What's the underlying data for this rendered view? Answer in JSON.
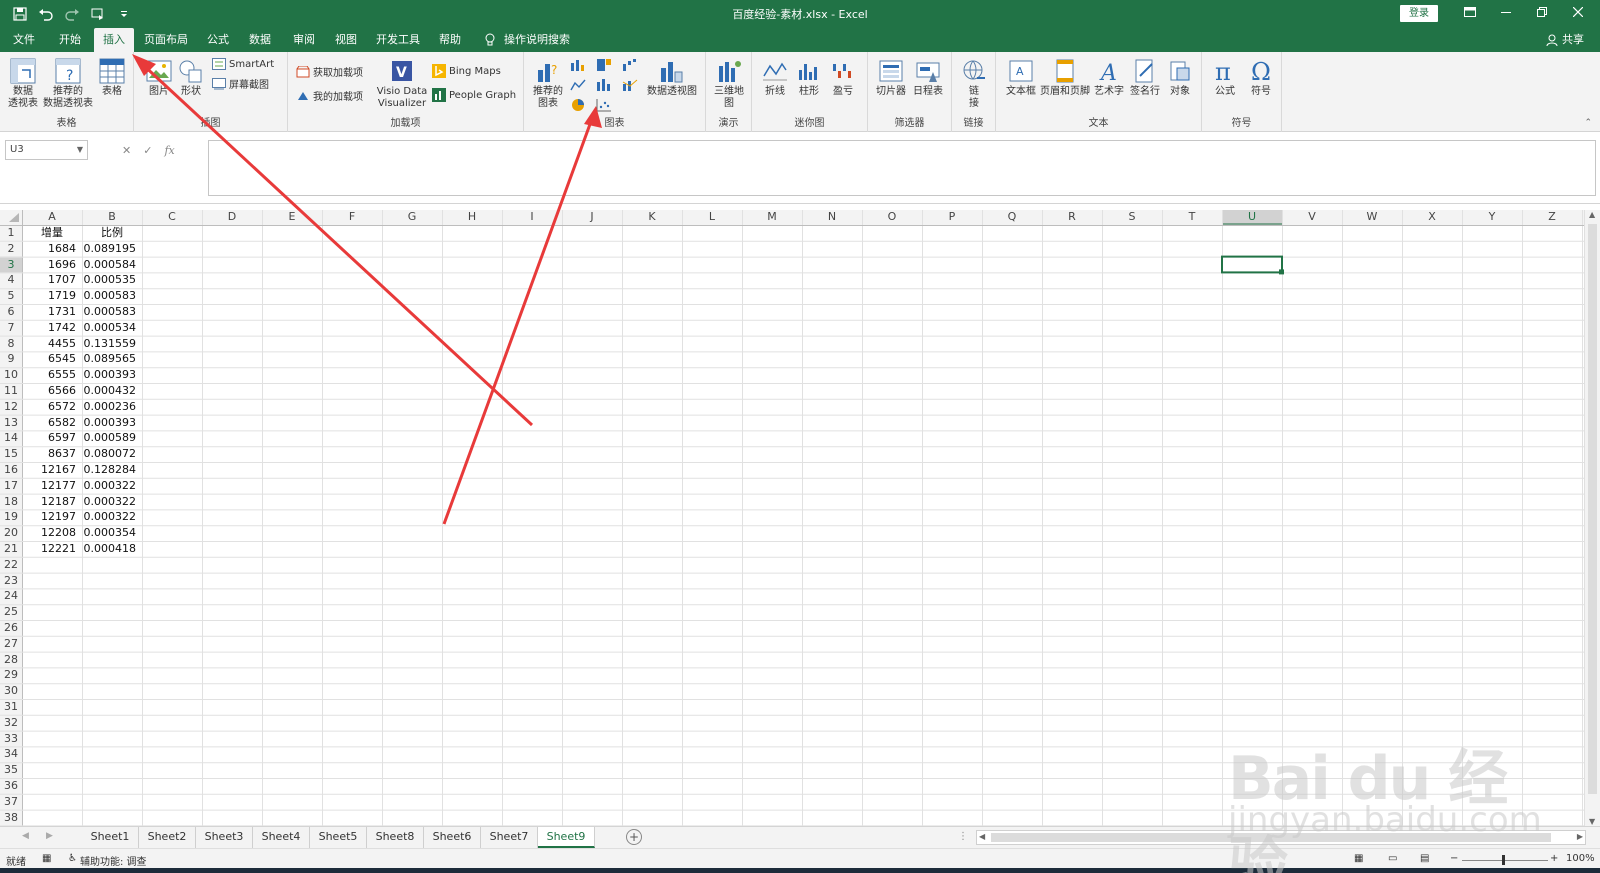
{
  "window": {
    "title": "百度经验-素材.xlsx  -  Excel",
    "login": "登录"
  },
  "tabs": [
    {
      "label": "文件"
    },
    {
      "label": "开始"
    },
    {
      "label": "插入",
      "active": true
    },
    {
      "label": "页面布局"
    },
    {
      "label": "公式"
    },
    {
      "label": "数据"
    },
    {
      "label": "审阅"
    },
    {
      "label": "视图"
    },
    {
      "label": "开发工具"
    },
    {
      "label": "帮助"
    }
  ],
  "search": {
    "label": "操作说明搜索"
  },
  "share": {
    "label": "共享"
  },
  "ribbon": {
    "tables": {
      "group": "表格",
      "pivot": "数据\n透视表",
      "recommended_pivot": "推荐的\n数据透视表",
      "table": "表格"
    },
    "illustrations": {
      "group": "插图",
      "pictures": "图片",
      "shapes": "形状",
      "smartart": "SmartArt",
      "screenshot": "屏幕截图"
    },
    "addins": {
      "group": "加载项",
      "get": "获取加载项",
      "my": "我的加载项",
      "visio": "Visio Data\nVisualizer",
      "bing": "Bing Maps",
      "people": "People Graph"
    },
    "charts": {
      "group": "图表",
      "recommended": "推荐的\n图表",
      "pivotchart": "数据透视图"
    },
    "tours": {
      "group": "演示",
      "map3d": "三维地\n图"
    },
    "sparklines": {
      "group": "迷你图",
      "line": "折线",
      "column": "柱形",
      "winloss": "盈亏"
    },
    "filters": {
      "group": "筛选器",
      "slicer": "切片器",
      "timeline": "日程表"
    },
    "links": {
      "group": "链接",
      "link": "链\n接"
    },
    "text": {
      "group": "文本",
      "textbox": "文本框",
      "headerfooter": "页眉和页脚",
      "wordart": "艺术字",
      "signature": "签名行",
      "object": "对象"
    },
    "symbols": {
      "group": "符号",
      "equation": "公式",
      "symbol": "符号"
    }
  },
  "formula_bar": {
    "name_box": "U3",
    "fx": "fx",
    "value": ""
  },
  "sheet": {
    "columns": [
      "A",
      "B",
      "C",
      "D",
      "E",
      "F",
      "G",
      "H",
      "I",
      "J",
      "K",
      "L",
      "M",
      "N",
      "O",
      "P",
      "Q",
      "R",
      "S",
      "T",
      "U",
      "V",
      "W",
      "X",
      "Y",
      "Z"
    ],
    "selected_column": "U",
    "selected_cell": "U3",
    "rows": 38,
    "header": [
      "增量",
      "比例"
    ],
    "data": [
      [
        "1684",
        "0.089195"
      ],
      [
        "1696",
        "0.000584"
      ],
      [
        "1707",
        "0.000535"
      ],
      [
        "1719",
        "0.000583"
      ],
      [
        "1731",
        "0.000583"
      ],
      [
        "1742",
        "0.000534"
      ],
      [
        "4455",
        "0.131559"
      ],
      [
        "6545",
        "0.089565"
      ],
      [
        "6555",
        "0.000393"
      ],
      [
        "6566",
        "0.000432"
      ],
      [
        "6572",
        "0.000236"
      ],
      [
        "6582",
        "0.000393"
      ],
      [
        "6597",
        "0.000589"
      ],
      [
        "8637",
        "0.080072"
      ],
      [
        "12167",
        "0.128284"
      ],
      [
        "12177",
        "0.000322"
      ],
      [
        "12187",
        "0.000322"
      ],
      [
        "12197",
        "0.000322"
      ],
      [
        "12208",
        "0.000354"
      ],
      [
        "12221",
        "0.000418"
      ]
    ]
  },
  "sheet_tabs": [
    {
      "label": "Sheet1"
    },
    {
      "label": "Sheet2"
    },
    {
      "label": "Sheet3"
    },
    {
      "label": "Sheet4"
    },
    {
      "label": "Sheet5"
    },
    {
      "label": "Sheet8"
    },
    {
      "label": "Sheet6"
    },
    {
      "label": "Sheet7"
    },
    {
      "label": "Sheet9",
      "active": true
    }
  ],
  "status": {
    "ready": "就绪",
    "accessibility": "辅助功能: 调查",
    "zoom": "100%"
  },
  "colors": {
    "brand": "#217346",
    "arrow": "#e83a3a"
  },
  "watermark": {
    "main": "Bai du 经验",
    "url": "jingyan.baidu.com"
  }
}
